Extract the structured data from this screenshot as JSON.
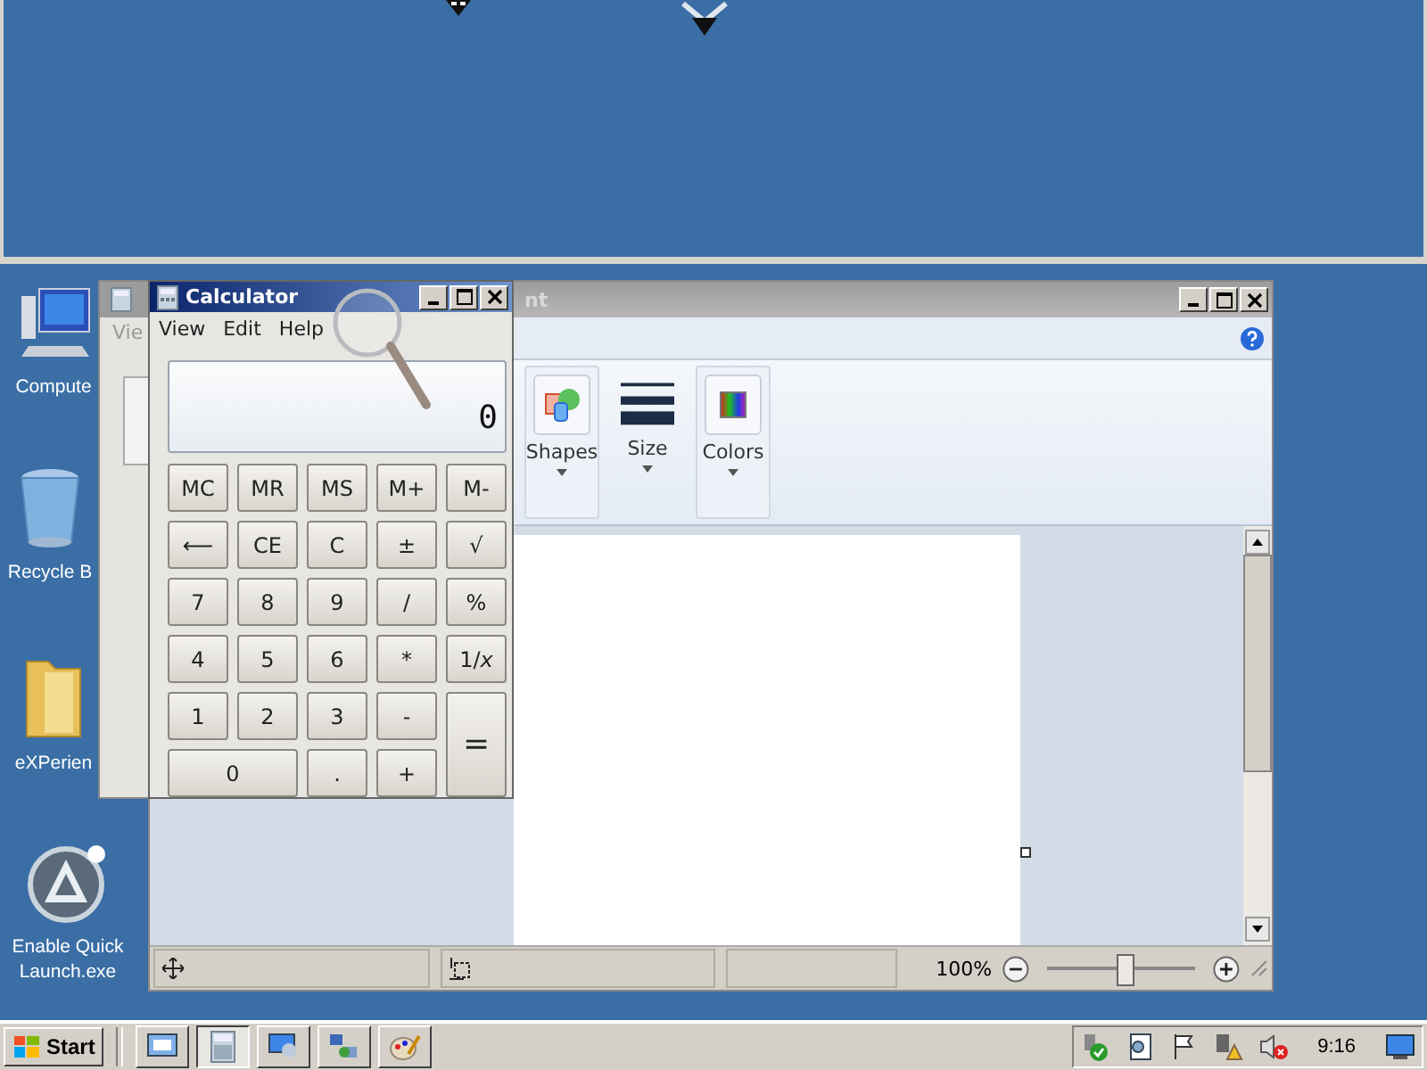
{
  "desktop_icons": [
    {
      "kind": "computer",
      "label": "Compute"
    },
    {
      "kind": "recycle-bin",
      "label": "Recycle B"
    },
    {
      "kind": "folder",
      "label": "eXPerien"
    },
    {
      "kind": "app",
      "label": "Enable Quick Launch.exe"
    }
  ],
  "background_calculator": {
    "menu": [
      "Vie"
    ]
  },
  "paint": {
    "title": "nt",
    "ribbon_groups": [
      {
        "kind": "shapes",
        "label": "Shapes"
      },
      {
        "kind": "size",
        "label": "Size"
      },
      {
        "kind": "colors",
        "label": "Colors"
      }
    ],
    "zoom": {
      "reading": "100%",
      "level": 0.52
    }
  },
  "calculator": {
    "title": "Calculator",
    "menu": [
      "View",
      "Edit",
      "Help"
    ],
    "display": "0",
    "buttons": [
      {
        "kind": "key",
        "label": "MC"
      },
      {
        "kind": "key",
        "label": "MR"
      },
      {
        "kind": "key",
        "label": "MS"
      },
      {
        "kind": "key",
        "label": "M+"
      },
      {
        "kind": "key",
        "label": "M-"
      },
      {
        "kind": "key",
        "label": "⟵"
      },
      {
        "kind": "key",
        "label": "CE"
      },
      {
        "kind": "key",
        "label": "C"
      },
      {
        "kind": "key",
        "label": "±"
      },
      {
        "kind": "key",
        "label": "√"
      },
      {
        "kind": "key",
        "label": "7"
      },
      {
        "kind": "key",
        "label": "8"
      },
      {
        "kind": "key",
        "label": "9"
      },
      {
        "kind": "key",
        "label": "/"
      },
      {
        "kind": "key",
        "label": "%"
      },
      {
        "kind": "key",
        "label": "4"
      },
      {
        "kind": "key",
        "label": "5"
      },
      {
        "kind": "key",
        "label": "6"
      },
      {
        "kind": "key",
        "label": "*"
      },
      {
        "kind": "key",
        "label": "1/*x*"
      },
      {
        "kind": "key",
        "label": "1"
      },
      {
        "kind": "key",
        "label": "2"
      },
      {
        "kind": "key",
        "label": "3"
      },
      {
        "kind": "key",
        "label": "-"
      },
      {
        "kind": "tall",
        "label": "="
      },
      {
        "kind": "wide",
        "label": "0"
      },
      {
        "kind": "key",
        "label": "."
      },
      {
        "kind": "key",
        "label": "+"
      }
    ]
  },
  "taskbar": {
    "start": "Start",
    "buttons": [
      {
        "kind": "server-manager",
        "selected": false
      },
      {
        "kind": "calculator",
        "selected": true
      },
      {
        "kind": "remote-desktop",
        "selected": false
      },
      {
        "kind": "network",
        "selected": false
      },
      {
        "kind": "paint",
        "selected": false
      }
    ],
    "clock": "9:16"
  }
}
